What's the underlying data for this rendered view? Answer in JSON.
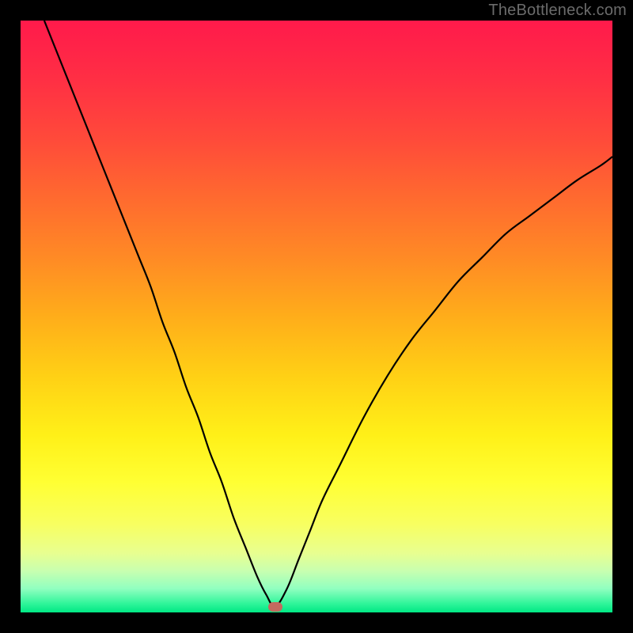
{
  "watermark": "TheBottleneck.com",
  "chart_data": {
    "type": "line",
    "title": "",
    "xlabel": "",
    "ylabel": "",
    "xlim": [
      0,
      100
    ],
    "ylim": [
      0,
      100
    ],
    "grid": false,
    "legend": "none",
    "series": [
      {
        "name": "bottleneck-curve",
        "x": [
          4,
          6,
          8,
          10,
          12,
          14,
          16,
          18,
          20,
          22,
          24,
          26,
          28,
          30,
          32,
          34,
          36,
          38,
          40,
          41.5,
          43,
          45,
          47,
          49,
          51,
          54,
          58,
          62,
          66,
          70,
          74,
          78,
          82,
          86,
          90,
          94,
          98,
          100
        ],
        "values": [
          100,
          95,
          90,
          85,
          80,
          75,
          70,
          65,
          60,
          55,
          49,
          44,
          38,
          33,
          27,
          22,
          16,
          11,
          6,
          3,
          1,
          4,
          9,
          14,
          19,
          25,
          33,
          40,
          46,
          51,
          56,
          60,
          64,
          67,
          70,
          73,
          75.5,
          77
        ]
      }
    ],
    "annotations": [
      {
        "name": "min-marker",
        "x": 43,
        "y": 1,
        "color": "#c46a5f"
      }
    ],
    "background_gradient": {
      "direction": "top-to-bottom",
      "stops": [
        {
          "pos": 0.0,
          "color": "#ff1a4b"
        },
        {
          "pos": 0.1,
          "color": "#ff2f44"
        },
        {
          "pos": 0.2,
          "color": "#ff4a3a"
        },
        {
          "pos": 0.3,
          "color": "#ff6a2f"
        },
        {
          "pos": 0.4,
          "color": "#ff8a25"
        },
        {
          "pos": 0.5,
          "color": "#ffad1a"
        },
        {
          "pos": 0.6,
          "color": "#ffd015"
        },
        {
          "pos": 0.7,
          "color": "#fff018"
        },
        {
          "pos": 0.78,
          "color": "#ffff33"
        },
        {
          "pos": 0.85,
          "color": "#f8ff60"
        },
        {
          "pos": 0.9,
          "color": "#e8ff90"
        },
        {
          "pos": 0.93,
          "color": "#c8ffb0"
        },
        {
          "pos": 0.96,
          "color": "#90ffc0"
        },
        {
          "pos": 0.985,
          "color": "#30f59a"
        },
        {
          "pos": 1.0,
          "color": "#00e884"
        }
      ]
    },
    "curve_color": "#000000",
    "curve_width": 2.2
  }
}
